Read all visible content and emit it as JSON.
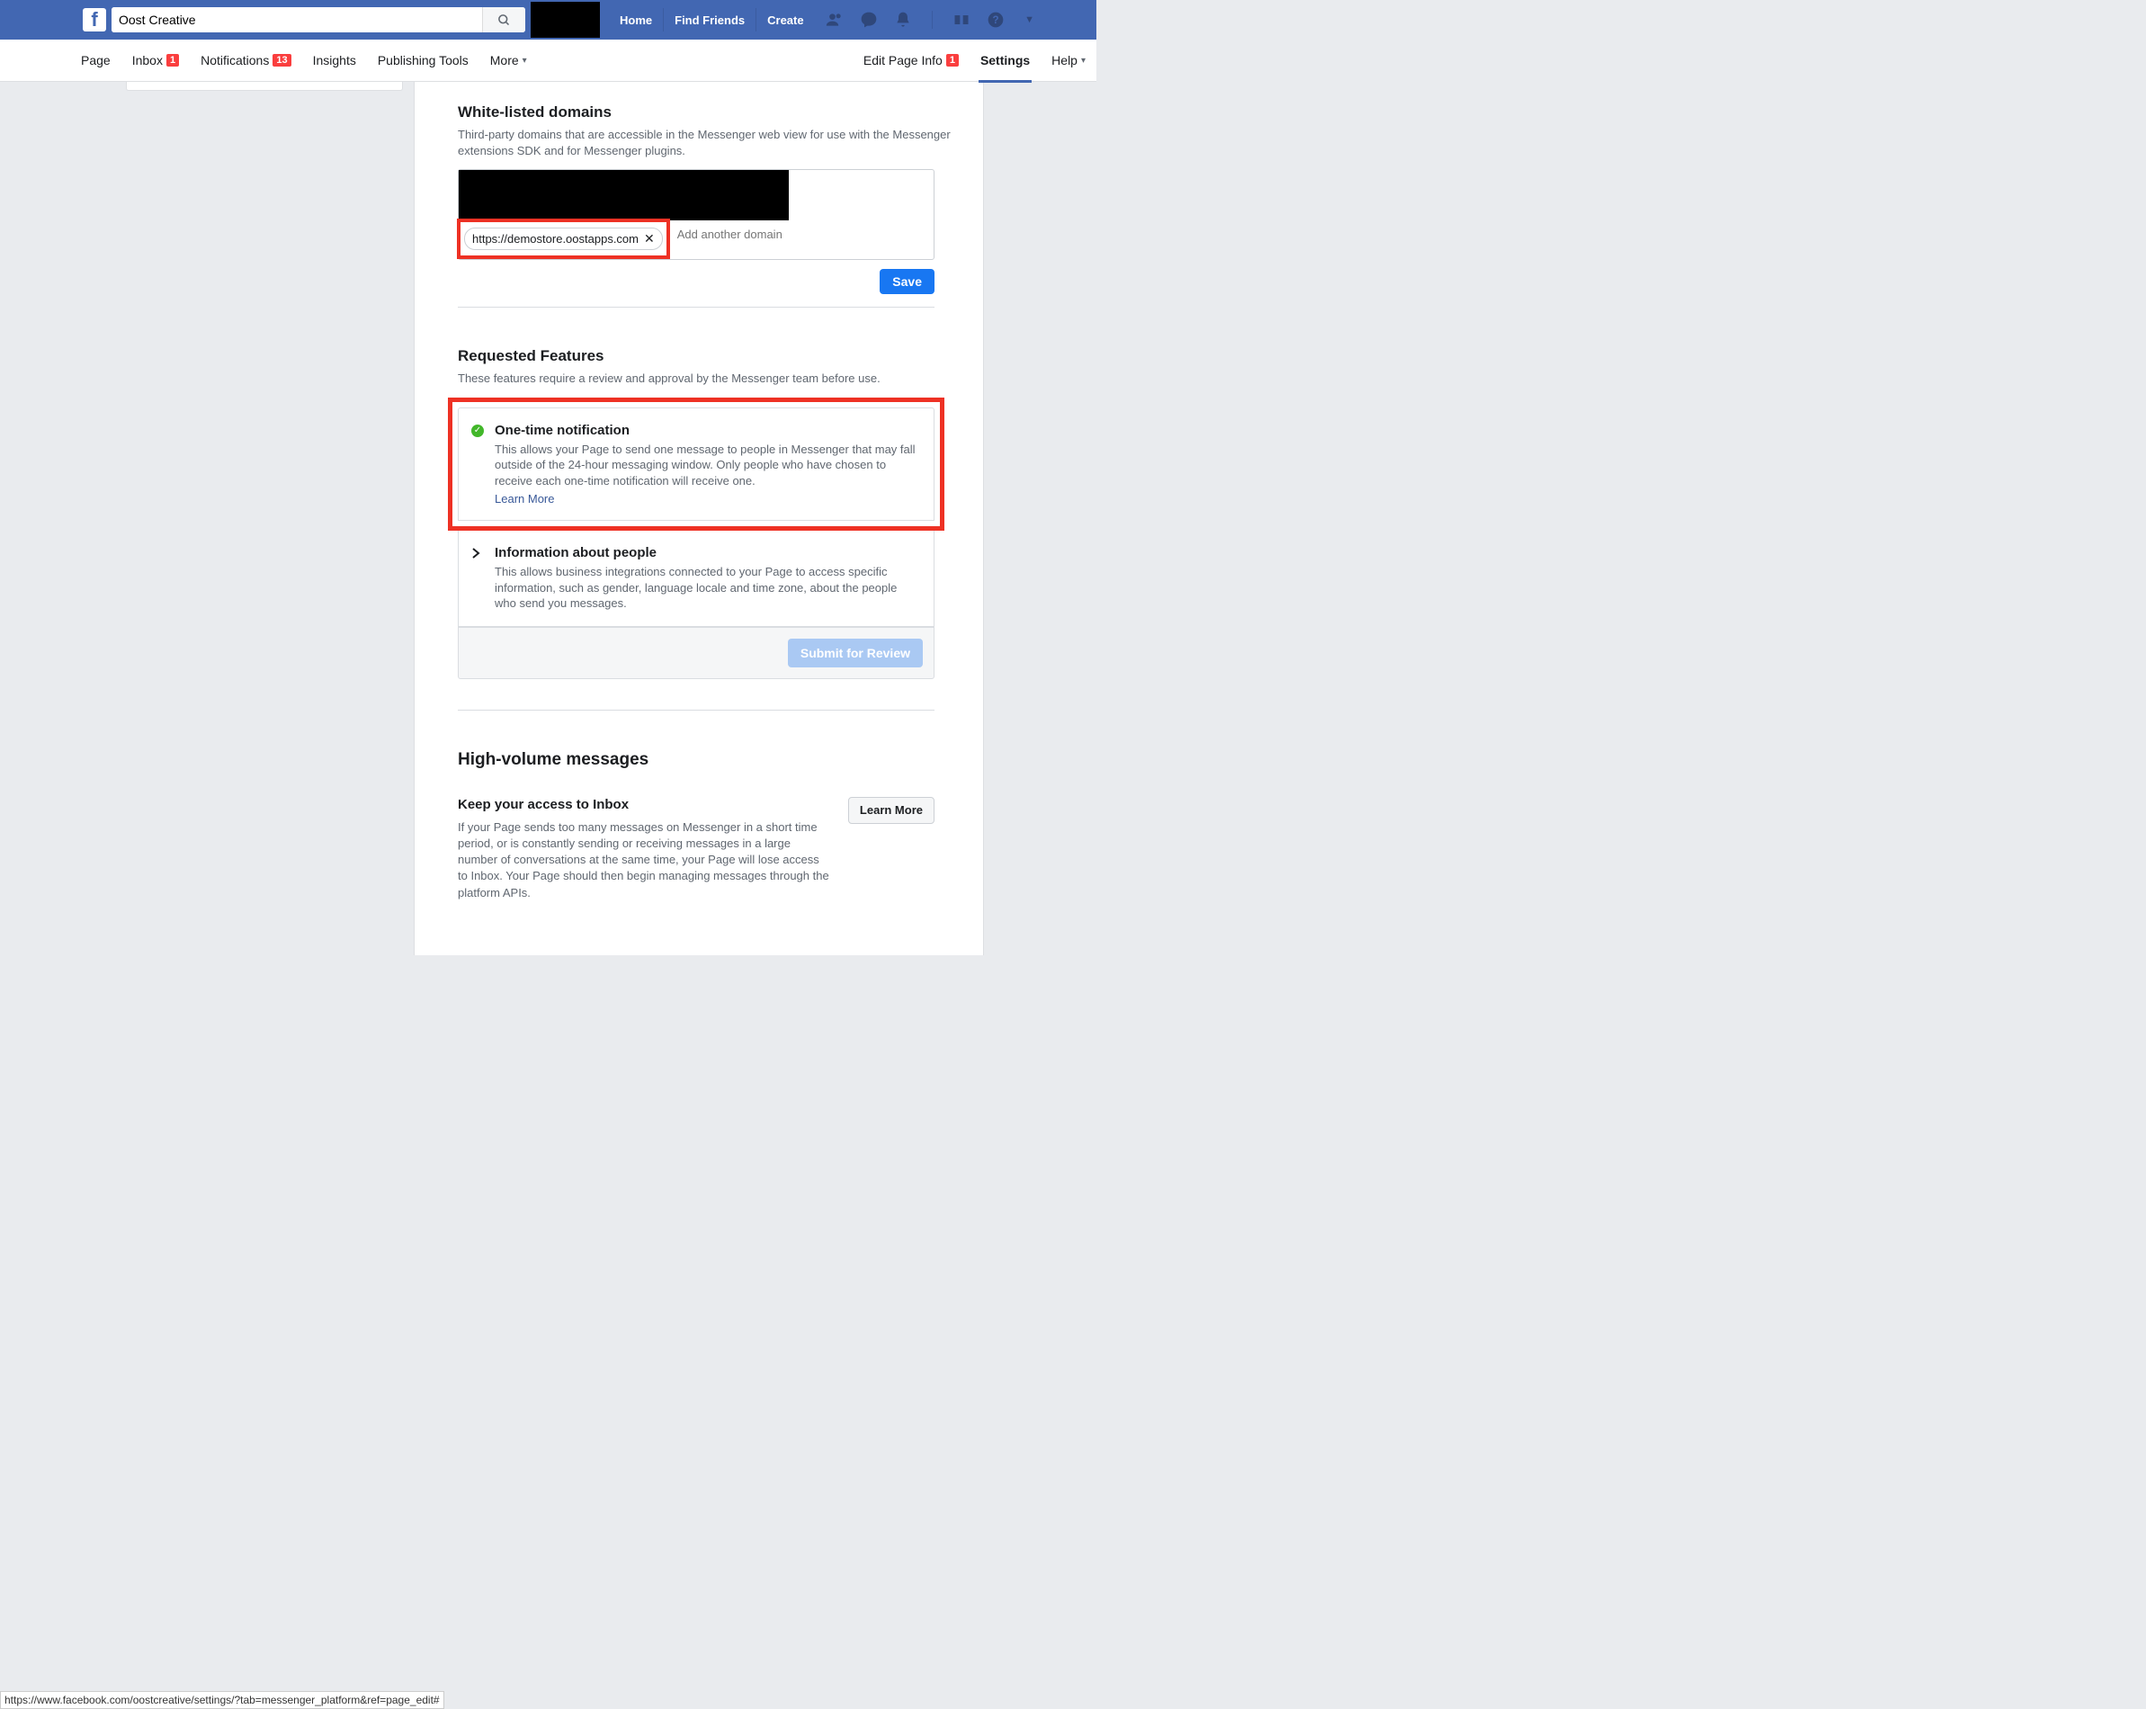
{
  "topbar": {
    "search_value": "Oost Creative",
    "nav": {
      "home": "Home",
      "find_friends": "Find Friends",
      "create": "Create"
    }
  },
  "tabs": {
    "page": "Page",
    "inbox": "Inbox",
    "inbox_badge": "1",
    "notifications": "Notifications",
    "notifications_badge": "13",
    "insights": "Insights",
    "publishing": "Publishing Tools",
    "more": "More",
    "edit_page_info": "Edit Page Info",
    "edit_page_info_badge": "1",
    "settings": "Settings",
    "help": "Help"
  },
  "whitelist": {
    "title": "White-listed domains",
    "desc": "Third-party domains that are accessible in the Messenger web view for use with the Messenger extensions SDK and for Messenger plugins.",
    "chip": "https://demostore.oostapps.com",
    "add_placeholder": "Add another domain",
    "save": "Save"
  },
  "requested": {
    "title": "Requested Features",
    "desc": "These features require a review and approval by the Messenger team before use.",
    "feat1_title": "One-time notification",
    "feat1_desc": "This allows your Page to send one message to people in Messenger that may fall outside of the 24-hour messaging window. Only people who have chosen to receive each one-time notification will receive one.",
    "learn_more": "Learn More",
    "feat2_title": "Information about people",
    "feat2_desc": "This allows business integrations connected to your Page to access specific information, such as gender, language locale and time zone, about the people who send you messages.",
    "submit": "Submit for Review"
  },
  "highvol": {
    "title": "High-volume messages",
    "subtitle": "Keep your access to Inbox",
    "desc": "If your Page sends too many messages on Messenger in a short time period, or is constantly sending or receiving messages in a large number of conversations at the same time, your Page will lose access to Inbox. Your Page should then begin managing messages through the platform APIs.",
    "learn_more": "Learn More"
  },
  "statusbar": "https://www.facebook.com/oostcreative/settings/?tab=messenger_platform&ref=page_edit#"
}
